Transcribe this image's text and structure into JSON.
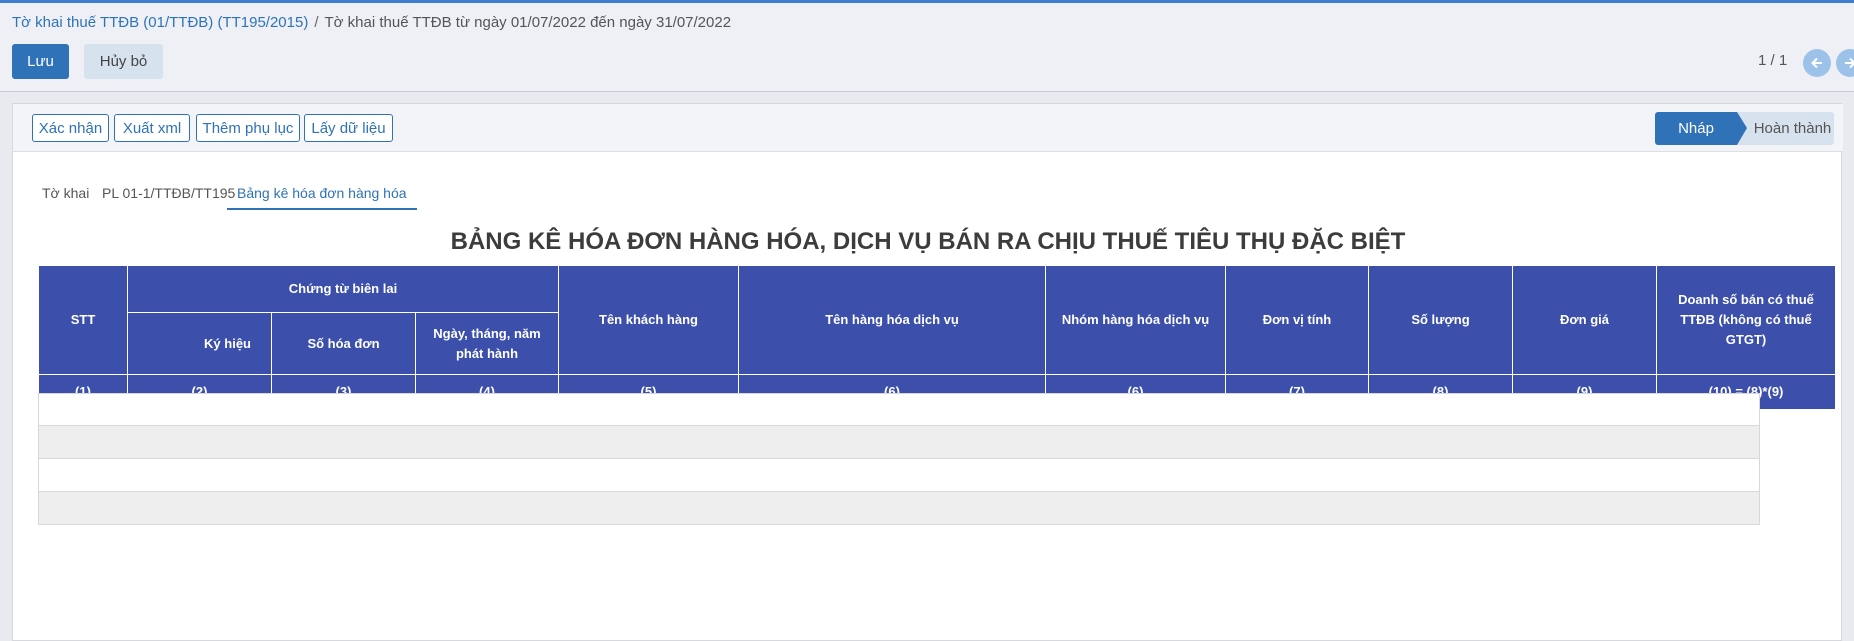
{
  "breadcrumb": {
    "link": "Tờ khai thuế TTĐB (01/TTĐB) (TT195/2015)",
    "separator": "/",
    "current": "Tờ khai thuế TTĐB từ ngày 01/07/2022 đến ngày 31/07/2022"
  },
  "actions": {
    "save": "Lưu",
    "cancel": "Hủy bỏ"
  },
  "pager": {
    "text": "1 / 1",
    "prev_icon": "arrow-left-icon",
    "next_icon": "arrow-right-icon"
  },
  "toolbar": {
    "confirm": "Xác nhận",
    "export_xml": "Xuất xml",
    "add_appendix": "Thêm phụ lục",
    "fetch_data": "Lấy dữ liệu"
  },
  "status_steps": {
    "active": "Nháp",
    "next": "Hoàn thành"
  },
  "tabs": [
    "Tờ khai",
    "PL 01-1/TTĐB/TT195",
    "Bảng kê hóa đơn hàng hóa"
  ],
  "active_tab": "Bảng kê hóa đơn hàng hóa",
  "title": "BẢNG KÊ HÓA ĐƠN HÀNG HÓA, DỊCH VỤ BÁN RA CHỊU THUẾ TIÊU THỤ ĐẶC BIỆT",
  "table": {
    "group_header": "Chứng từ biên lai",
    "columns": {
      "stt": "STT",
      "ky_hieu": "Ký hiệu",
      "so_hoa_don": "Số hóa đơn",
      "ngay": "Ngày, tháng, năm phát hành",
      "khach_hang": "Tên khách hàng",
      "hang_hoa": "Tên hàng hóa dịch vụ",
      "nhom": "Nhóm hàng hóa dịch vụ",
      "don_vi": "Đơn vị tính",
      "so_luong": "Số lượng",
      "don_gia": "Đơn giá",
      "doanh_so": "Doanh số bán có thuế TTĐB (không có thuế GTGT)"
    },
    "numbers": [
      "(1)",
      "(2)",
      "(3)",
      "(4)",
      "(5)",
      "(6)",
      "(6)",
      "(7)",
      "(8)",
      "(9)",
      "(10) = (8)*(9)"
    ],
    "rows": [
      {
        "stt": "",
        "ky_hieu": "",
        "so_hoa_don": ""
      },
      {
        "stt": "",
        "ky_hieu": "",
        "so_hoa_don": ""
      },
      {
        "stt": "",
        "ky_hieu": "",
        "so_hoa_don": ""
      },
      {
        "stt": "",
        "ky_hieu": "",
        "so_hoa_don": ""
      }
    ]
  },
  "colors": {
    "primary": "#2f72b8",
    "table_header": "#3b4fab"
  }
}
